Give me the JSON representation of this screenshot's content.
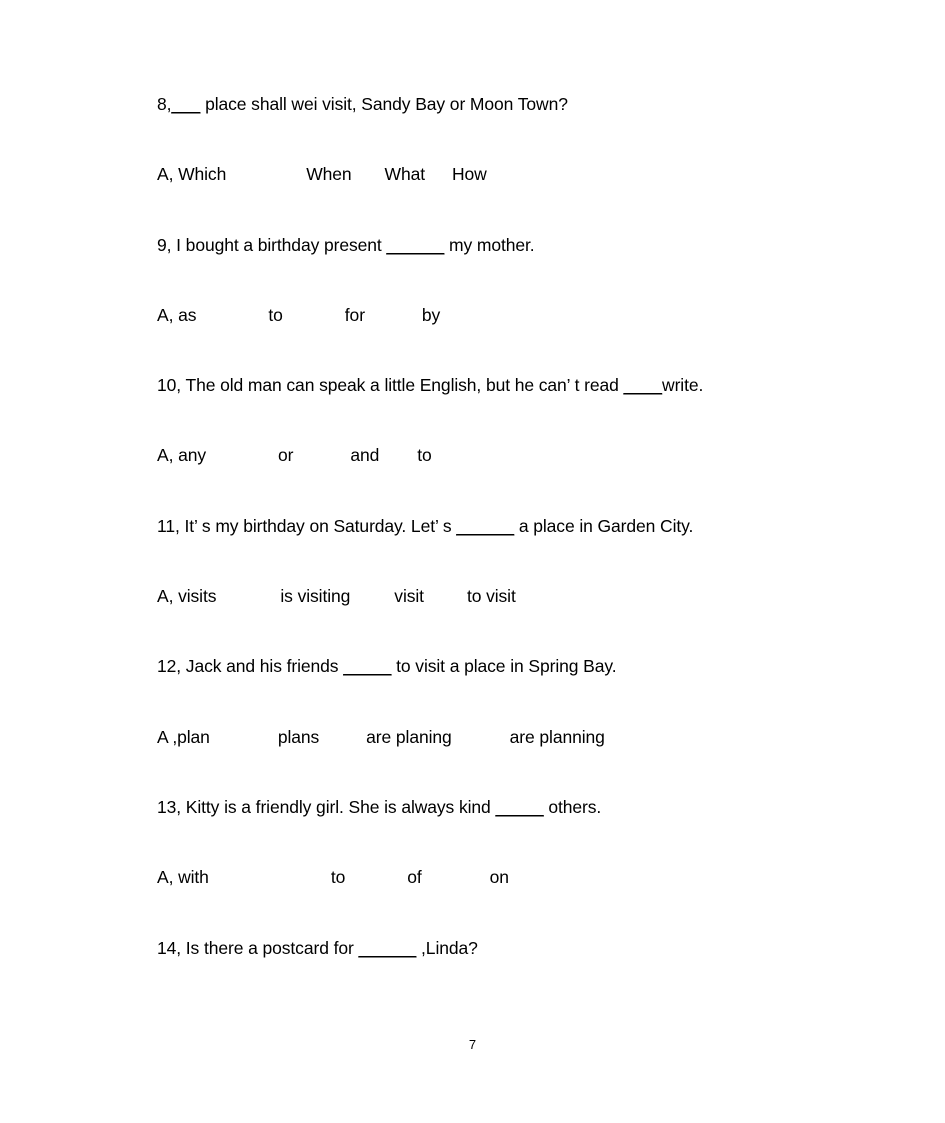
{
  "document": {
    "page_number": "7",
    "background_color": "#ffffff",
    "text_color": "#000000",
    "items": [
      {
        "type": "question",
        "number": "8",
        "text": "8,___ place shall wei visit, Sandy Bay or Moon Town?",
        "prefix": "8,",
        "blank": "___",
        "suffix": " place shall wei visit, Sandy Bay or Moon Town?"
      },
      {
        "type": "options",
        "label": "A, Which",
        "choices": [
          "A, Which",
          "When",
          "What",
          "How"
        ],
        "offsets": [
          0,
          150,
          252,
          333
        ]
      },
      {
        "type": "question",
        "number": "9",
        "text": "9, I bought a birthday present ______ my mother.",
        "prefix": "9, I bought a birthday present ",
        "blank": "______",
        "suffix": " my mother."
      },
      {
        "type": "options",
        "label": "A, as",
        "choices": [
          "A, as",
          "to",
          "for",
          "by"
        ],
        "offsets": [
          0,
          114,
          193,
          272
        ]
      },
      {
        "type": "question",
        "number": "10",
        "text": "10, The old man can speak a little English, but he can’ t read ____write.",
        "prefix": "10, The old man can speak a little English, but he can’ t read ",
        "blank": "____",
        "suffix": "write."
      },
      {
        "type": "options",
        "label": "A, any",
        "choices": [
          "A, any",
          "or",
          "and",
          "to"
        ],
        "offsets": [
          0,
          118,
          195,
          268
        ]
      },
      {
        "type": "question",
        "number": "11",
        "text": "11, It’ s my birthday on Saturday. Let’ s ______ a place in Garden City.",
        "prefix": "11, It’ s my birthday on Saturday. Let’ s ",
        "blank": "______",
        "suffix": " a place in Garden City."
      },
      {
        "type": "options",
        "label": "A, visits",
        "choices": [
          "A, visits",
          "is visiting",
          "visit",
          "to visit"
        ],
        "offsets": [
          0,
          127,
          252,
          328
        ]
      },
      {
        "type": "question",
        "number": "12",
        "text": "12, Jack and his friends ____ to visit a place in Spring Bay.",
        "prefix": "12, Jack and his friends ",
        "blank": "_____",
        "suffix": " to visit a place in Spring Bay."
      },
      {
        "type": "options",
        "label": "A ,plan",
        "choices": [
          "A ,plan",
          "plans",
          "are planing",
          "are planning"
        ],
        "offsets": [
          0,
          122,
          220,
          375
        ]
      },
      {
        "type": "question",
        "number": "13",
        "text": "13, Kitty is a friendly girl. She is always kind ____ others.",
        "prefix": "13, Kitty is a friendly girl. She is always kind ",
        "blank": "_____",
        "suffix": " others."
      },
      {
        "type": "options",
        "label": "A, with",
        "choices": [
          "A, with",
          "to",
          "of",
          "on"
        ],
        "offsets": [
          0,
          178,
          258,
          345
        ]
      },
      {
        "type": "question",
        "number": "14",
        "text": "14, Is there a postcard for ______ ,Linda?",
        "prefix": "14, Is there a postcard for ",
        "blank": "______",
        "suffix": " ,Linda?"
      }
    ]
  }
}
